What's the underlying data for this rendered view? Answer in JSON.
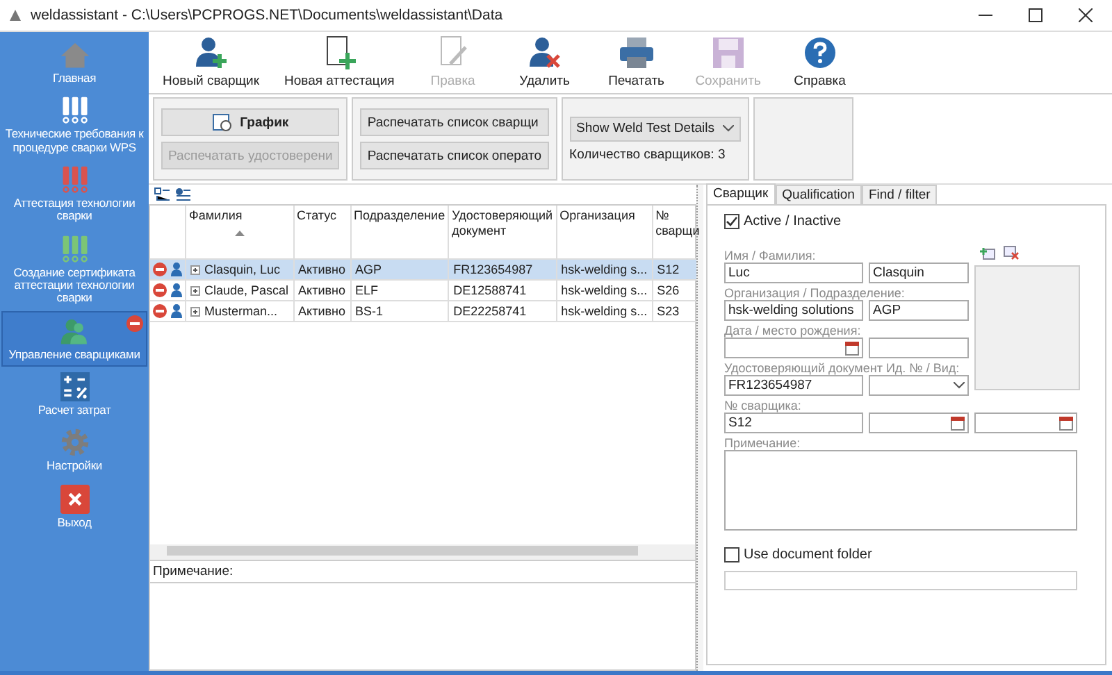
{
  "window": {
    "title": "weldassistant - C:\\Users\\PCPROGS.NET\\Documents\\weldassistant\\Data"
  },
  "sidebar": {
    "items": [
      {
        "label": "Главная",
        "kind": "home",
        "selected": false
      },
      {
        "label": "Технические требования к процедуре сварки WPS",
        "kind": "wps",
        "selected": false
      },
      {
        "label": "Аттестация технологии сварки",
        "kind": "wpq",
        "selected": false
      },
      {
        "label": "Создание сертификата аттестации технологии сварки",
        "kind": "certificate",
        "selected": false
      },
      {
        "label": "Управление сварщиками",
        "kind": "welders",
        "selected": true
      },
      {
        "label": "Расчет затрат",
        "kind": "costs",
        "selected": false
      },
      {
        "label": "Настройки",
        "kind": "settings",
        "selected": false
      },
      {
        "label": "Выход",
        "kind": "exit",
        "selected": false
      }
    ]
  },
  "toolbar": {
    "buttons": [
      {
        "label": "Новый сварщик",
        "kind": "new-welder",
        "disabled": false
      },
      {
        "label": "Новая аттестация",
        "kind": "new-document",
        "disabled": false
      },
      {
        "label": "Правка",
        "kind": "edit",
        "disabled": true
      },
      {
        "label": "Удалить",
        "kind": "delete-welder",
        "disabled": false
      },
      {
        "label": "Печатать",
        "kind": "print",
        "disabled": false
      },
      {
        "label": "Сохранить",
        "kind": "save",
        "disabled": true
      },
      {
        "label": "Справка",
        "kind": "help",
        "disabled": false
      }
    ]
  },
  "ribbon": {
    "schedule_button": {
      "label": "График",
      "disabled": false
    },
    "print_certificate_button": {
      "label": "Распечатать удостоверени",
      "disabled": true
    },
    "print_buttons": [
      {
        "label": "Распечатать список сварщи",
        "disabled": false
      },
      {
        "label": "Распечатать список операто",
        "disabled": false
      }
    ],
    "view_select": {
      "value": "Show Weld Test Details"
    },
    "welder_count": "Количество сварщиков: 3"
  },
  "table": {
    "columns": [
      {
        "label": "Фамилия",
        "sort_ascending": true
      },
      {
        "label": "Статус",
        "sort_ascending": false
      },
      {
        "label": "Подразделение",
        "sort_ascending": false
      },
      {
        "label": "Удостоверяющий документ",
        "sort_ascending": false
      },
      {
        "label": "Организация",
        "sort_ascending": false
      },
      {
        "label": "№ сварщи",
        "sort_ascending": false
      }
    ],
    "rows": [
      {
        "selected": true,
        "cells": [
          "Clasquin, Luc",
          "Активно",
          "AGP",
          "FR123654987",
          "hsk-welding s...",
          "S12"
        ]
      },
      {
        "selected": false,
        "cells": [
          "Claude, Pascal",
          "Активно",
          "ELF",
          "DE12588741",
          "hsk-welding s...",
          "S26"
        ]
      },
      {
        "selected": false,
        "cells": [
          "Musterman...",
          "Активно",
          "BS-1",
          "DE22258741",
          "hsk-welding s...",
          "S23"
        ]
      }
    ]
  },
  "note": {
    "label": "Примечание:"
  },
  "welder_form": {
    "tabs": [
      {
        "label": "Сварщик",
        "selected": true
      },
      {
        "label": "Qualification",
        "selected": false
      },
      {
        "label": "Find / filter",
        "selected": false
      }
    ],
    "active_checkbox": {
      "label": "Active / Inactive",
      "checked": true
    },
    "name_label": "Имя / Фамилия:",
    "first_name": "Luc",
    "last_name": "Clasquin",
    "organization_label": "Организация / Подразделение:",
    "organization": "hsk-welding solutions",
    "department": "AGP",
    "birth_label": "Дата / место рождения:",
    "id_label": "Удостоверяющий документ Ид. № / Вид:",
    "id_number": "FR123654987",
    "welder_number_label": "№ сварщика:",
    "welder_number": "S12",
    "note_label": "Примечание:",
    "folder_checkbox": {
      "label": "Use document folder",
      "checked": false
    }
  }
}
